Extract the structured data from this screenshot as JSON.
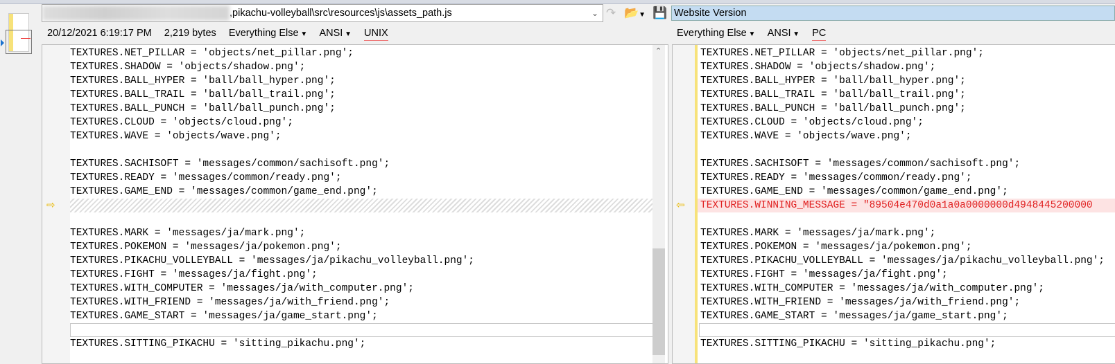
{
  "left": {
    "path": ",pikachu-volleyball\\src\\resources\\js\\assets_path.js",
    "date": "20/12/2021 6:19:17 PM",
    "size": "2,219 bytes",
    "format": "Everything Else",
    "encoding": "ANSI",
    "line_endings": "UNIX"
  },
  "right": {
    "title": "Website Version",
    "format": "Everything Else",
    "encoding": "ANSI",
    "line_endings": "PC"
  },
  "lines_left": [
    "TEXTURES.NET_PILLAR = 'objects/net_pillar.png';",
    "TEXTURES.SHADOW = 'objects/shadow.png';",
    "TEXTURES.BALL_HYPER = 'ball/ball_hyper.png';",
    "TEXTURES.BALL_TRAIL = 'ball/ball_trail.png';",
    "TEXTURES.BALL_PUNCH = 'ball/ball_punch.png';",
    "TEXTURES.CLOUD = 'objects/cloud.png';",
    "TEXTURES.WAVE = 'objects/wave.png';",
    "",
    "TEXTURES.SACHISOFT = 'messages/common/sachisoft.png';",
    "TEXTURES.READY = 'messages/common/ready.png';",
    "TEXTURES.GAME_END = 'messages/common/game_end.png';",
    "",
    "",
    "TEXTURES.MARK = 'messages/ja/mark.png';",
    "TEXTURES.POKEMON = 'messages/ja/pokemon.png';",
    "TEXTURES.PIKACHU_VOLLEYBALL = 'messages/ja/pikachu_volleyball.png';",
    "TEXTURES.FIGHT = 'messages/ja/fight.png';",
    "TEXTURES.WITH_COMPUTER = 'messages/ja/with_computer.png';",
    "TEXTURES.WITH_FRIEND = 'messages/ja/with_friend.png';",
    "TEXTURES.GAME_START = 'messages/ja/game_start.png';",
    "",
    "TEXTURES.SITTING_PIKACHU = 'sitting_pikachu.png';"
  ],
  "lines_right": [
    "TEXTURES.NET_PILLAR = 'objects/net_pillar.png';",
    "TEXTURES.SHADOW = 'objects/shadow.png';",
    "TEXTURES.BALL_HYPER = 'ball/ball_hyper.png';",
    "TEXTURES.BALL_TRAIL = 'ball/ball_trail.png';",
    "TEXTURES.BALL_PUNCH = 'ball/ball_punch.png';",
    "TEXTURES.CLOUD = 'objects/cloud.png';",
    "TEXTURES.WAVE = 'objects/wave.png';",
    "",
    "TEXTURES.SACHISOFT = 'messages/common/sachisoft.png';",
    "TEXTURES.READY = 'messages/common/ready.png';",
    "TEXTURES.GAME_END = 'messages/common/game_end.png';",
    "TEXTURES.WINNING_MESSAGE = \"89504e470d0a1a0a0000000d4948445200000",
    "",
    "TEXTURES.MARK = 'messages/ja/mark.png';",
    "TEXTURES.POKEMON = 'messages/ja/pokemon.png';",
    "TEXTURES.PIKACHU_VOLLEYBALL = 'messages/ja/pikachu_volleyball.png';",
    "TEXTURES.FIGHT = 'messages/ja/fight.png';",
    "TEXTURES.WITH_COMPUTER = 'messages/ja/with_computer.png';",
    "TEXTURES.WITH_FRIEND = 'messages/ja/with_friend.png';",
    "TEXTURES.GAME_START = 'messages/ja/game_start.png';",
    "",
    "TEXTURES.SITTING_PIKACHU = 'sitting_pikachu.png';"
  ],
  "colors": {
    "diff_text": "#e02020",
    "diff_bg": "#fde3e3",
    "change_bar": "#f7e27a",
    "selection": "#c4dcf2"
  }
}
